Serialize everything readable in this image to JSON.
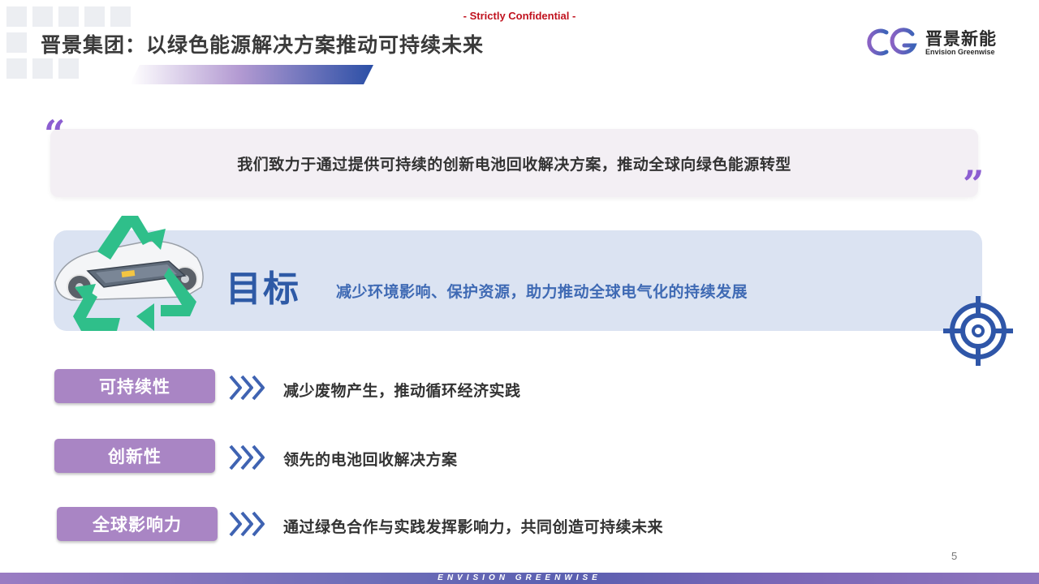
{
  "header": {
    "confidential": "- Strictly Confidential -",
    "title": "晋景集团：以绿色能源解决方案推动可持续未来",
    "logo_cn": "晋景新能",
    "logo_en": "Envision Greenwise"
  },
  "quote": {
    "open_mark": "“",
    "close_mark": "”",
    "text": "我们致力于通过提供可持续的创新电池回收解决方案，推动全球向绿色能源转型"
  },
  "goal": {
    "title": "目标",
    "description": "减少环境影响、保护资源，助力推动全球电气化的持续发展"
  },
  "pillars": [
    {
      "label": "可持续性",
      "text": "减少废物产生，推动循环经济实践"
    },
    {
      "label": "创新性",
      "text": "领先的电池回收解决方案"
    },
    {
      "label": "全球影响力",
      "text": "通过绿色合作与实践发挥影响力，共同创造可持续未来"
    }
  ],
  "footer": {
    "page_number": "5",
    "brand": "ENVISION GREENWISE"
  },
  "colors": {
    "accent_purple": "#a985c4",
    "goal_blue": "#2e5aa6",
    "confidential_red": "#c0121e",
    "recycle_green": "#2fbf8a"
  },
  "icons": [
    "recycle-battery-icon",
    "target-icon",
    "chevron-right-icon",
    "quote-open-icon",
    "quote-close-icon",
    "logo-eg-icon"
  ]
}
